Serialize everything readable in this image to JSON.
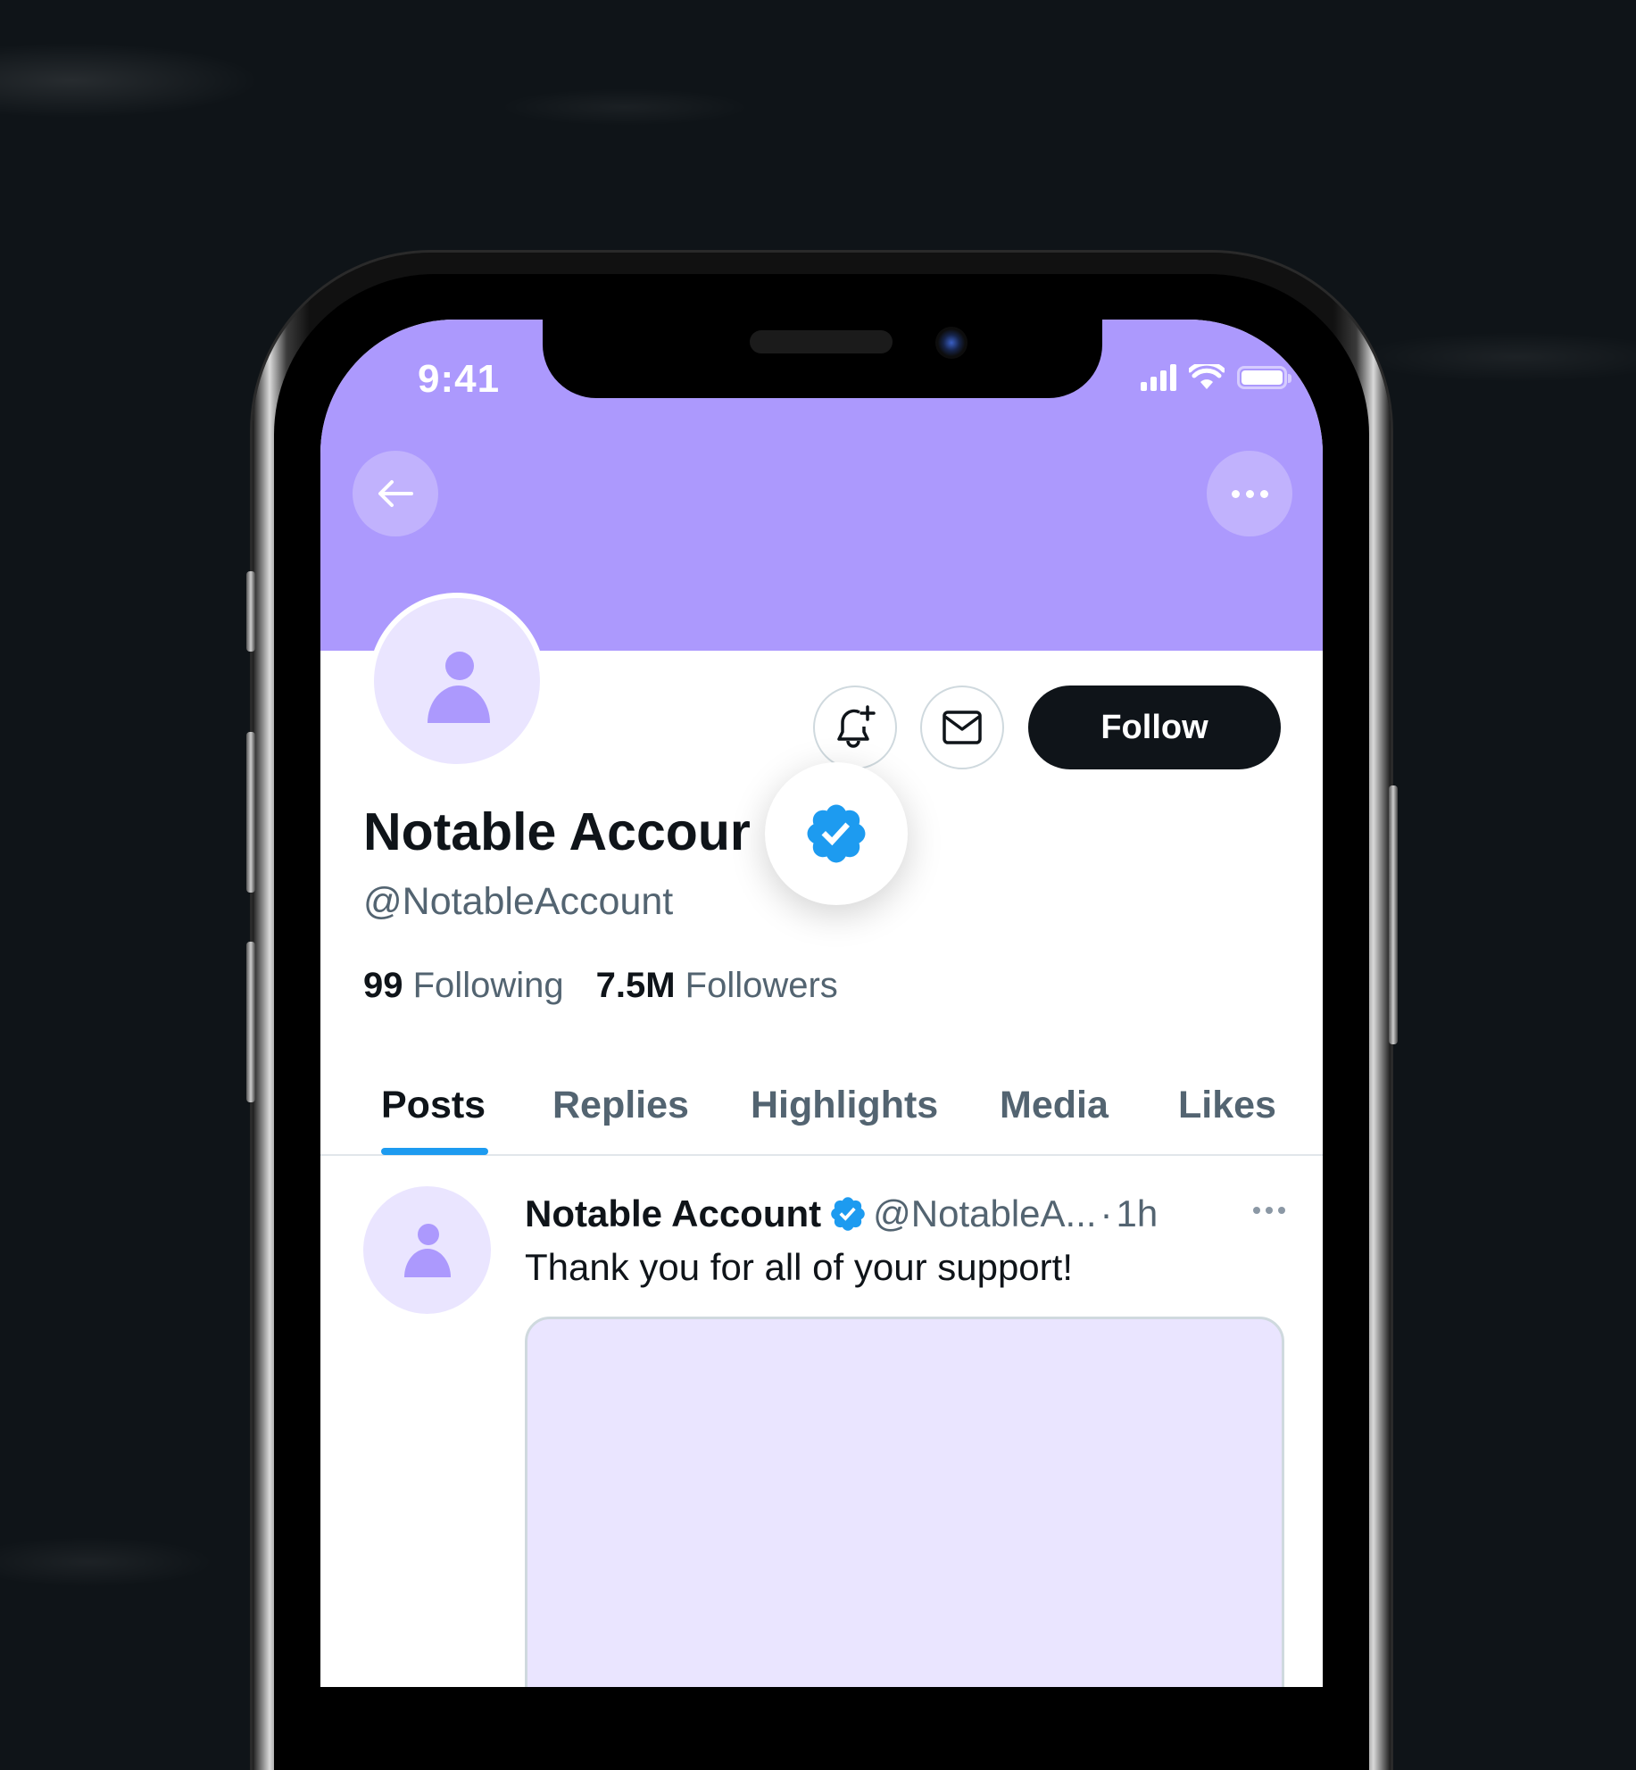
{
  "status_bar": {
    "time": "9:41",
    "icons": [
      "cellular-signal-icon",
      "wifi-icon",
      "battery-icon"
    ]
  },
  "header": {
    "back_icon": "arrow-left-icon",
    "more_icon": "more-horizontal-icon"
  },
  "profile": {
    "display_name": "Notable Account",
    "display_name_visible": "Notable Accour",
    "handle": "@NotableAccount",
    "verified": true,
    "following_count": "99",
    "following_label": "Following",
    "followers_count": "7.5M",
    "followers_label": "Followers",
    "follow_label": "Follow",
    "notify_icon": "bell-plus-icon",
    "message_icon": "mail-icon"
  },
  "tabs": [
    {
      "label": "Posts",
      "active": true
    },
    {
      "label": "Replies",
      "active": false
    },
    {
      "label": "Highlights",
      "active": false
    },
    {
      "label": "Media",
      "active": false
    },
    {
      "label": "Likes",
      "active": false
    }
  ],
  "post": {
    "author_name": "Notable Account",
    "author_handle": "@NotableA...",
    "separator": "·",
    "time": "1h",
    "text": "Thank you for all of your support!"
  },
  "colors": {
    "banner": "#ac99fd",
    "avatar_bg": "#eae5ff",
    "avatar_fg": "#ac99fd",
    "accent_blue": "#1d9bf0",
    "follow_button": "#0f1419",
    "secondary_text": "#536471"
  }
}
